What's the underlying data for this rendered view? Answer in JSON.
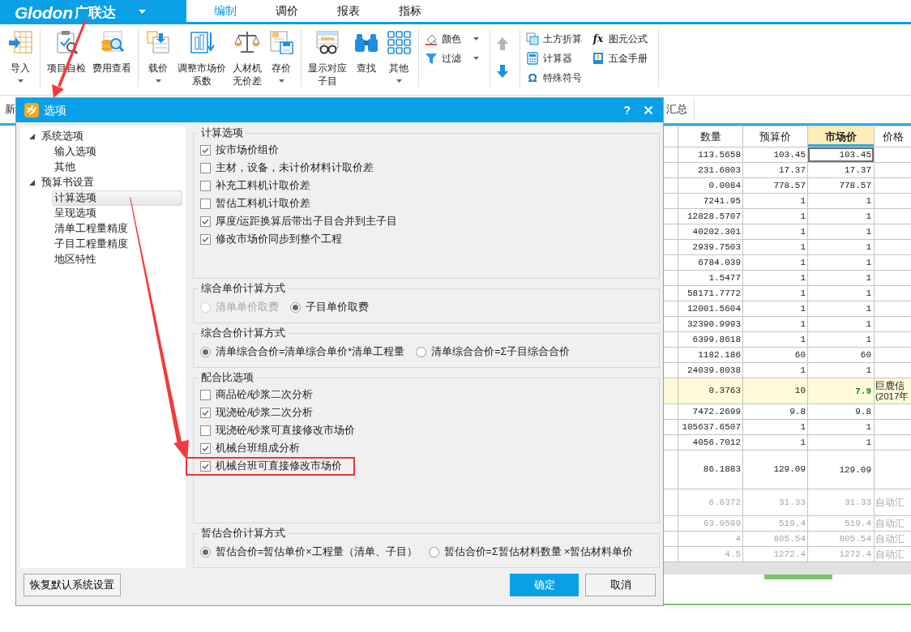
{
  "app": {
    "brand_latin": "Glodon",
    "brand_cn": "广联达"
  },
  "ribbon_tabs": [
    {
      "label": "编制",
      "selected": true
    },
    {
      "label": "调价",
      "selected": false
    },
    {
      "label": "报表",
      "selected": false
    },
    {
      "label": "指标",
      "selected": false
    }
  ],
  "ribbon": {
    "groups": [
      {
        "items": [
          {
            "kind": "large",
            "label": [
              "导入"
            ],
            "menu": true
          }
        ]
      },
      {
        "items": [
          {
            "kind": "large",
            "label": [
              "项目自检"
            ],
            "menu": false
          },
          {
            "kind": "large",
            "label": [
              "费用查看"
            ],
            "menu": false
          }
        ]
      },
      {
        "items": [
          {
            "kind": "large",
            "label": [
              "载价"
            ],
            "menu": true
          },
          {
            "kind": "large",
            "label": [
              "调整市场价",
              "系数"
            ],
            "menu": false
          },
          {
            "kind": "large",
            "label": [
              "人材机",
              "无价差"
            ],
            "menu": false
          },
          {
            "kind": "large",
            "label": [
              "存价"
            ],
            "menu": true
          }
        ]
      },
      {
        "items": [
          {
            "kind": "large",
            "label": [
              "显示对应",
              "子目"
            ],
            "menu": false
          },
          {
            "kind": "large",
            "label": [
              "查找"
            ],
            "menu": false
          },
          {
            "kind": "large",
            "label": [
              "其他"
            ],
            "menu": true
          }
        ]
      },
      {
        "items": [
          {
            "kind": "stack",
            "entries": [
              {
                "label": "颜色",
                "menu": true
              },
              {
                "label": "过滤",
                "menu": true
              }
            ]
          }
        ]
      },
      {
        "items": [
          {
            "kind": "arrows"
          }
        ]
      },
      {
        "items": [
          {
            "kind": "stack",
            "entries": [
              {
                "label": "土方折算"
              },
              {
                "label": "计算器"
              },
              {
                "label": "特殊符号",
                "glyph": "Ω"
              }
            ]
          },
          {
            "kind": "stack",
            "entries": [
              {
                "label": "图元公式",
                "glyph": "fx"
              },
              {
                "label": "五金手册"
              }
            ]
          }
        ]
      }
    ]
  },
  "doc_tabs": {
    "left": "新",
    "right": "汇总"
  },
  "table": {
    "columns": [
      {
        "label": "数量",
        "selected": false
      },
      {
        "label": "预算价",
        "selected": false
      },
      {
        "label": "市场价",
        "selected": true
      },
      {
        "label": "价格",
        "selected": false
      }
    ],
    "rows": [
      {
        "kind": "normal",
        "quantity": "113.5658",
        "budget_price": "103.45",
        "market_price": "103.45",
        "selected": true
      },
      {
        "kind": "normal",
        "quantity": "231.6803",
        "budget_price": "17.37",
        "market_price": "17.37",
        "selected": false
      },
      {
        "kind": "normal",
        "quantity": "0.0084",
        "budget_price": "778.57",
        "market_price": "778.57",
        "selected": false
      },
      {
        "kind": "normal",
        "quantity": "7241.95",
        "budget_price": "1",
        "market_price": "1",
        "selected": false
      },
      {
        "kind": "normal",
        "quantity": "12828.5707",
        "budget_price": "1",
        "market_price": "1",
        "selected": false
      },
      {
        "kind": "normal",
        "quantity": "40202.301",
        "budget_price": "1",
        "market_price": "1",
        "selected": false
      },
      {
        "kind": "normal",
        "quantity": "2939.7503",
        "budget_price": "1",
        "market_price": "1",
        "selected": false
      },
      {
        "kind": "normal",
        "quantity": "6784.039",
        "budget_price": "1",
        "market_price": "1",
        "selected": false
      },
      {
        "kind": "normal",
        "quantity": "1.5477",
        "budget_price": "1",
        "market_price": "1",
        "selected": false
      },
      {
        "kind": "normal",
        "quantity": "58171.7772",
        "budget_price": "1",
        "market_price": "1",
        "selected": false
      },
      {
        "kind": "normal",
        "quantity": "12001.5604",
        "budget_price": "1",
        "market_price": "1",
        "selected": false
      },
      {
        "kind": "normal",
        "quantity": "32390.9993",
        "budget_price": "1",
        "market_price": "1",
        "selected": false
      },
      {
        "kind": "normal",
        "quantity": "6399.8618",
        "budget_price": "1",
        "market_price": "1",
        "selected": false
      },
      {
        "kind": "normal",
        "quantity": "1182.186",
        "budget_price": "60",
        "market_price": "60",
        "selected": false
      },
      {
        "kind": "normal",
        "quantity": "24039.8038",
        "budget_price": "1",
        "market_price": "1",
        "selected": false
      },
      {
        "kind": "highlight",
        "quantity": "0.3763",
        "budget_price": "10",
        "market_price": "7.9",
        "source": [
          "巨鹿信",
          "(2017年"
        ],
        "selected": false
      },
      {
        "kind": "normal",
        "quantity": "7472.2699",
        "budget_price": "9.8",
        "market_price": "9.8",
        "selected": false
      },
      {
        "kind": "normal",
        "quantity": "105637.6507",
        "budget_price": "1",
        "market_price": "1",
        "selected": false
      },
      {
        "kind": "normal",
        "quantity": "4056.7012",
        "budget_price": "1",
        "market_price": "1",
        "selected": false
      },
      {
        "kind": "tall",
        "quantity": "86.1883",
        "budget_price": "129.09",
        "market_price": "129.09",
        "selected": false
      },
      {
        "kind": "auto_tall",
        "quantity": "6.6372",
        "budget_price": "31.33",
        "market_price": "31.33",
        "source": [
          "自动汇"
        ],
        "selected": false
      },
      {
        "kind": "auto",
        "quantity": "63.9599",
        "budget_price": "519.4",
        "market_price": "519.4",
        "source": [
          "自动汇"
        ],
        "selected": false
      },
      {
        "kind": "auto",
        "quantity": "4",
        "budget_price": "805.54",
        "market_price": "805.54",
        "source": [
          "自动汇"
        ],
        "selected": false
      },
      {
        "kind": "auto",
        "quantity": "4.5",
        "budget_price": "1272.4",
        "market_price": "1272.4",
        "source": [
          "自动汇"
        ],
        "selected": false
      }
    ]
  },
  "dialog": {
    "title": "选项",
    "help": "?",
    "tree": [
      {
        "label": "系统选项",
        "expanded": true,
        "selected": false,
        "children": [
          {
            "label": "输入选项",
            "selected": false
          },
          {
            "label": "其他",
            "selected": false
          }
        ]
      },
      {
        "label": "预算书设置",
        "expanded": true,
        "selected": false,
        "children": [
          {
            "label": "计算选项",
            "selected": true
          },
          {
            "label": "呈现选项",
            "selected": false
          },
          {
            "label": "清单工程量精度",
            "selected": false
          },
          {
            "label": "子目工程量精度",
            "selected": false
          },
          {
            "label": "地区特性",
            "selected": false
          }
        ]
      }
    ],
    "sections": [
      {
        "title": "计算选项",
        "kind": "checks",
        "options": [
          {
            "label": "按市场价组价",
            "checked": true,
            "highlighted": false
          },
          {
            "label": "主材，设备，未计价材料计取价差",
            "checked": false,
            "highlighted": false
          },
          {
            "label": "补充工料机计取价差",
            "checked": false,
            "highlighted": false
          },
          {
            "label": "暂估工料机计取价差",
            "checked": false,
            "highlighted": false
          },
          {
            "label": "厚度/运距换算后带出子目合并到主子目",
            "checked": true,
            "highlighted": false
          },
          {
            "label": "修改市场价同步到整个工程",
            "checked": true,
            "highlighted": false
          }
        ]
      },
      {
        "title": "综合单价计算方式",
        "kind": "radios",
        "options": [
          {
            "label": "清单单价取费",
            "selected": false,
            "disabled": true
          },
          {
            "label": "子目单价取费",
            "selected": true,
            "disabled": false
          }
        ]
      },
      {
        "title": "综合合价计算方式",
        "kind": "radios",
        "options": [
          {
            "label": "清单综合合价=清单综合单价*清单工程量",
            "selected": true,
            "disabled": false
          },
          {
            "label": "清单综合合价=Σ子目综合合价",
            "selected": false,
            "disabled": false
          }
        ]
      },
      {
        "title": "配合比选项",
        "kind": "checks",
        "options": [
          {
            "label": "商品砼/砂浆二次分析",
            "checked": false,
            "highlighted": false
          },
          {
            "label": "现浇砼/砂浆二次分析",
            "checked": true,
            "highlighted": false
          },
          {
            "label": "现浇砼/砂浆可直接修改市场价",
            "checked": false,
            "highlighted": false
          },
          {
            "label": "机械台班组成分析",
            "checked": true,
            "highlighted": false
          },
          {
            "label": "机械台班可直接修改市场价",
            "checked": true,
            "highlighted": true
          }
        ]
      },
      {
        "title": "暂估合价计算方式",
        "kind": "radios",
        "options": [
          {
            "label": "暂估合价=暂估单价×工程量（清单、子目）",
            "selected": true,
            "disabled": false
          },
          {
            "label": "暂估合价=Σ暂估材料数量 ×暂估材料单价",
            "selected": false,
            "disabled": false
          }
        ]
      }
    ],
    "restore_button": "恢复默认系统设置",
    "ok_button": "确定",
    "cancel_button": "取消"
  }
}
